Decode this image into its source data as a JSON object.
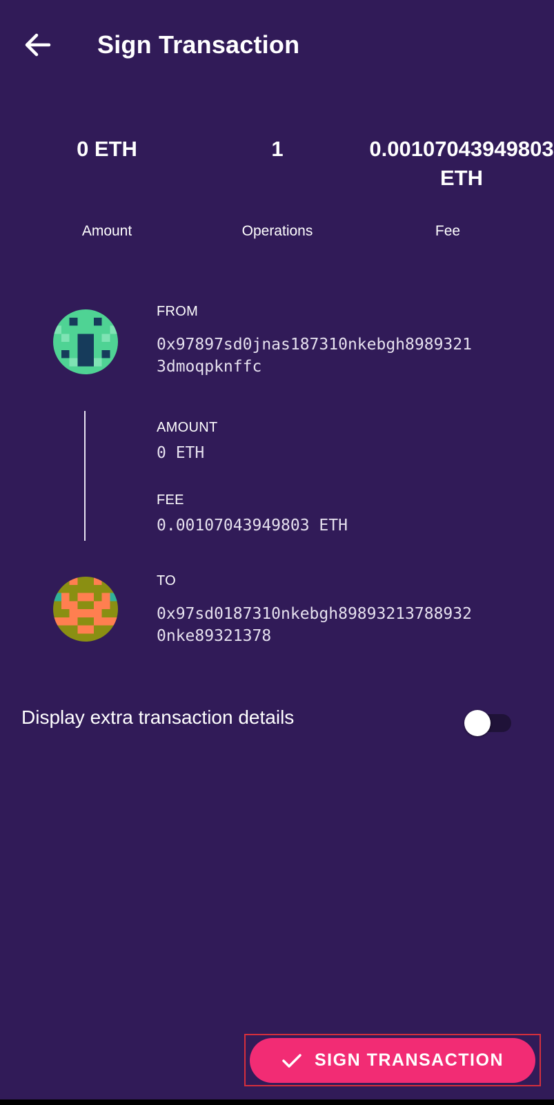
{
  "app_bar": {
    "title": "Sign Transaction",
    "back_icon": "arrow-left-icon"
  },
  "summary": {
    "amount_value": "0 ETH",
    "amount_label": "Amount",
    "operations_value": "1",
    "operations_label": "Operations",
    "fee_value": "0.00107043949803 ETH",
    "fee_label": "Fee"
  },
  "from": {
    "label": "FROM",
    "address_line1": "0x97897sd0jnas187310nkebgh8989321",
    "address_line2": "3dmoqpknffc",
    "avatar_icon": "identicon-green-avatar"
  },
  "details": {
    "amount_label": "AMOUNT",
    "amount_value": "0 ETH",
    "fee_label": "FEE",
    "fee_value": "0.00107043949803 ETH"
  },
  "to": {
    "label": "TO",
    "address_line1": "0x97sd0187310nkebgh89893213788932",
    "address_line2": "0nke89321378",
    "avatar_icon": "identicon-orange-avatar"
  },
  "extra_details": {
    "label": "Display extra transaction details",
    "enabled": false
  },
  "sign_button": {
    "label": "SIGN TRANSACTION",
    "icon": "check-icon"
  },
  "colors": {
    "background": "#311b58",
    "accent": "#f22c74",
    "highlight_border": "#d62f3c",
    "from_avatar_primary": "#4fd394",
    "from_avatar_secondary": "#163b5b",
    "to_avatar_primary": "#ff7f50",
    "to_avatar_secondary": "#8a8f12",
    "to_avatar_tertiary": "#30b29a"
  }
}
